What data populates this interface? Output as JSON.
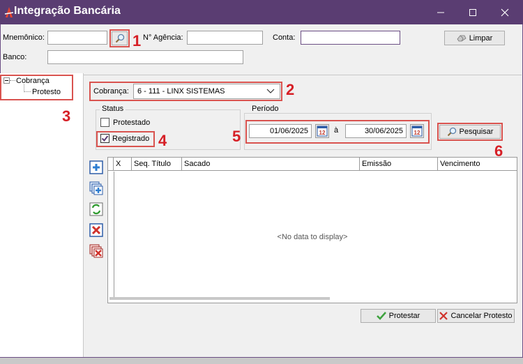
{
  "window": {
    "title": "Integração Bancária",
    "controls": [
      "minimize",
      "maximize",
      "close"
    ]
  },
  "filters": {
    "mnemonico_label": "Mnemônico:",
    "mnemonico_value": "",
    "agencia_label": "N° Agência:",
    "agencia_value": "",
    "conta_label": "Conta:",
    "conta_value": "",
    "banco_label": "Banco:",
    "banco_value": "",
    "limpar_label": "Limpar"
  },
  "tree": {
    "root": "Cobrança",
    "child": "Protesto"
  },
  "cobranca": {
    "label": "Cobrança:",
    "selected": "6 - 111 - LINX SISTEMAS"
  },
  "status": {
    "title": "Status",
    "protestado_label": "Protestado",
    "protestado_checked": false,
    "registrado_label": "Registrado",
    "registrado_checked": true
  },
  "periodo": {
    "title": "Período",
    "start": "01/06/2025",
    "separator": "à",
    "end": "30/06/2025"
  },
  "pesquisar_label": "Pesquisar",
  "grid": {
    "columns": [
      "X",
      "Seq. Título",
      "Sacado",
      "Emissão",
      "Vencimento"
    ],
    "empty_text": "<No data to display>"
  },
  "actions": {
    "protestar_label": "Protestar",
    "cancelar_label": "Cancelar Protesto"
  },
  "annotations": [
    "1",
    "2",
    "3",
    "4",
    "5",
    "6"
  ],
  "colors": {
    "titlebar": "#5a3d72",
    "annotation": "#d61f26",
    "highlight_border": "#d9534f"
  }
}
